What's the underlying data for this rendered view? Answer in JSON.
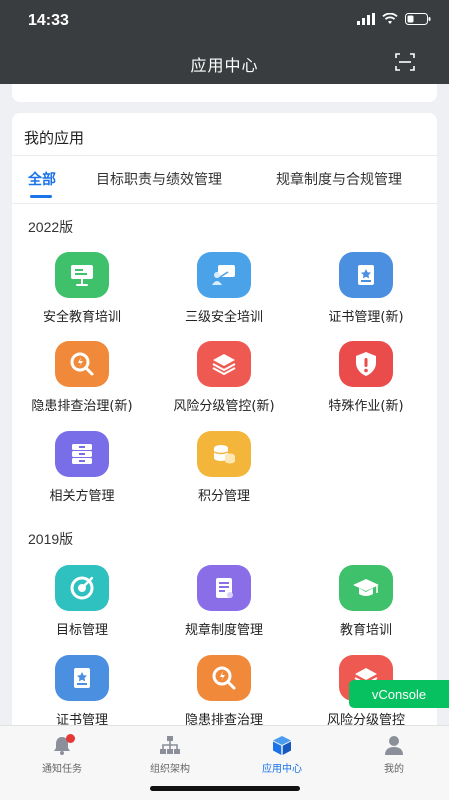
{
  "status_bar": {
    "time": "14:33"
  },
  "header": {
    "title": "应用中心"
  },
  "card": {
    "title": "我的应用"
  },
  "tabs": [
    {
      "label": "全部"
    },
    {
      "label": "目标职责与绩效管理"
    },
    {
      "label": "规章制度与合规管理"
    }
  ],
  "sections": [
    {
      "title": "2022版",
      "apps": [
        {
          "label": "安全教育培训",
          "icon": "presentation-icon",
          "color": "#3fc06a"
        },
        {
          "label": "三级安全培训",
          "icon": "classroom-icon",
          "color": "#4aa3e8"
        },
        {
          "label": "证书管理(新)",
          "icon": "certificate-icon",
          "color": "#4a8fe0"
        },
        {
          "label": "隐患排查治理(新)",
          "icon": "hazard-search-icon",
          "color": "#f08a3a"
        },
        {
          "label": "风险分级管控(新)",
          "icon": "layers-icon",
          "color": "#ee5a52"
        },
        {
          "label": "特殊作业(新)",
          "icon": "shield-alert-icon",
          "color": "#ea4b4b"
        },
        {
          "label": "相关方管理",
          "icon": "archive-icon",
          "color": "#7a6ee8"
        },
        {
          "label": "积分管理",
          "icon": "coins-icon",
          "color": "#f3b53a"
        }
      ]
    },
    {
      "title": "2019版",
      "apps": [
        {
          "label": "目标管理",
          "icon": "target-icon",
          "color": "#2fc0c0"
        },
        {
          "label": "规章制度管理",
          "icon": "document-icon",
          "color": "#8a6ee8"
        },
        {
          "label": "教育培训",
          "icon": "graduation-cap-icon",
          "color": "#3fc06a"
        },
        {
          "label": "证书管理",
          "icon": "certificate-icon",
          "color": "#4a8fe0"
        },
        {
          "label": "隐患排查治理",
          "icon": "hazard-search-icon",
          "color": "#f08a3a"
        },
        {
          "label": "风险分级管控",
          "icon": "layers-icon",
          "color": "#ee5a52"
        }
      ]
    }
  ],
  "vconsole": {
    "label": "vConsole"
  },
  "tabbar": [
    {
      "label": "通知任务",
      "icon": "bell-icon"
    },
    {
      "label": "组织架构",
      "icon": "org-chart-icon"
    },
    {
      "label": "应用中心",
      "icon": "cube-icon"
    },
    {
      "label": "我的",
      "icon": "user-icon"
    }
  ]
}
